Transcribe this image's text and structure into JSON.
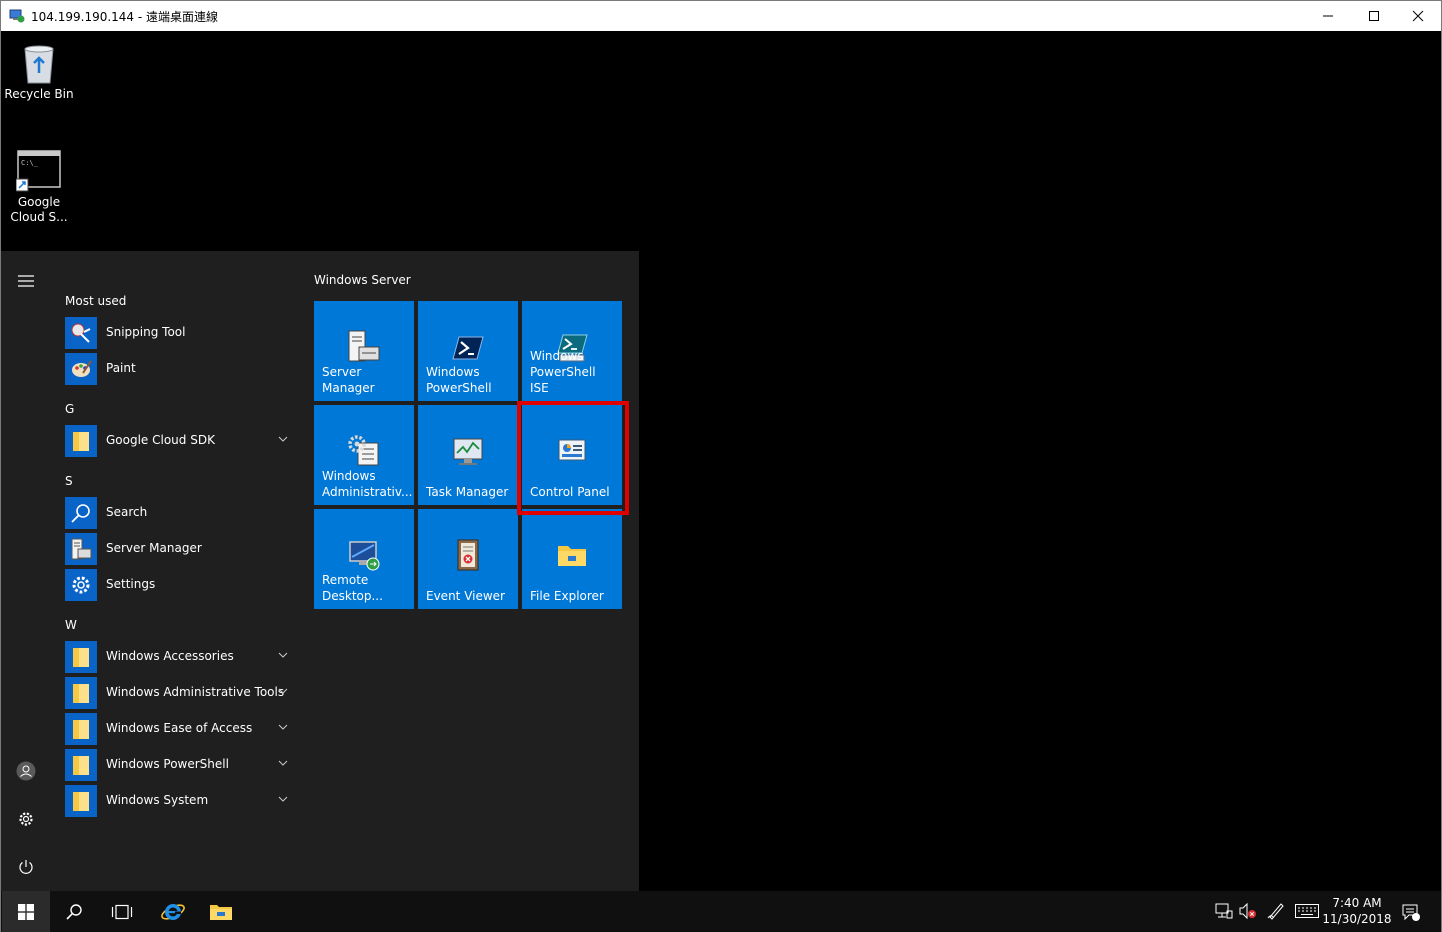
{
  "window": {
    "title": "104.199.190.144 - 遠端桌面連線"
  },
  "desktop": {
    "icons": [
      {
        "label": "Recycle Bin"
      },
      {
        "label": "Google Cloud S..."
      }
    ]
  },
  "start_menu": {
    "most_used_heading": "Most used",
    "most_used": [
      {
        "label": "Snipping Tool",
        "icon": "snipping-tool-icon"
      },
      {
        "label": "Paint",
        "icon": "paint-icon"
      }
    ],
    "groups": [
      {
        "letter": "G",
        "items": [
          {
            "label": "Google Cloud SDK",
            "icon": "folder-icon",
            "expandable": true
          }
        ]
      },
      {
        "letter": "S",
        "items": [
          {
            "label": "Search",
            "icon": "search-icon",
            "expandable": false
          },
          {
            "label": "Server Manager",
            "icon": "server-manager-icon",
            "expandable": false
          },
          {
            "label": "Settings",
            "icon": "gear-icon",
            "expandable": false
          }
        ]
      },
      {
        "letter": "W",
        "items": [
          {
            "label": "Windows Accessories",
            "icon": "folder-icon",
            "expandable": true
          },
          {
            "label": "Windows Administrative Tools",
            "icon": "folder-icon",
            "expandable": true
          },
          {
            "label": "Windows Ease of Access",
            "icon": "folder-icon",
            "expandable": true
          },
          {
            "label": "Windows PowerShell",
            "icon": "folder-icon",
            "expandable": true
          },
          {
            "label": "Windows System",
            "icon": "folder-icon",
            "expandable": true
          }
        ]
      }
    ],
    "tile_group_title": "Windows Server",
    "tiles": [
      {
        "label": "Server Manager",
        "icon": "server-manager-icon"
      },
      {
        "label": "Windows PowerShell",
        "icon": "powershell-icon"
      },
      {
        "label": "Windows PowerShell ISE",
        "icon": "powershell-ise-icon"
      },
      {
        "label": "Windows Administrativ...",
        "icon": "admin-tools-icon"
      },
      {
        "label": "Task Manager",
        "icon": "task-manager-icon"
      },
      {
        "label": "Control Panel",
        "icon": "control-panel-icon",
        "highlighted": true
      },
      {
        "label": "Remote Desktop...",
        "icon": "remote-desktop-icon"
      },
      {
        "label": "Event Viewer",
        "icon": "event-viewer-icon"
      },
      {
        "label": "File Explorer",
        "icon": "file-explorer-icon"
      }
    ]
  },
  "taskbar": {
    "clock_time": "7:40 AM",
    "clock_date": "11/30/2018"
  },
  "colors": {
    "tile": "#0078d7",
    "icon_bg": "#0a64c8",
    "start_bg": "#1f1f1f",
    "highlight": "#e00000"
  }
}
